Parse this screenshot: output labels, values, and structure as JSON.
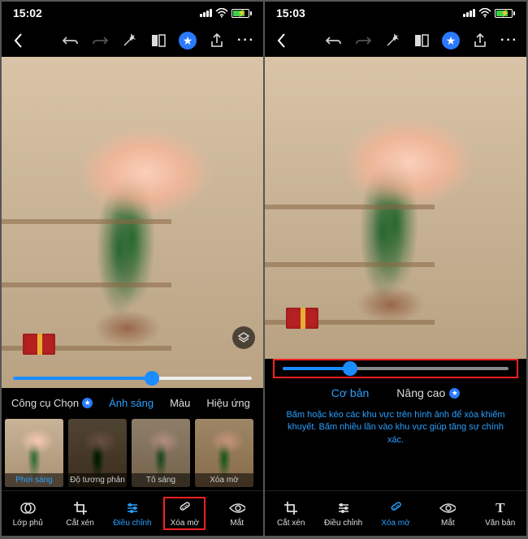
{
  "screens": [
    {
      "status": {
        "time": "15:02"
      },
      "slider": {
        "percent": 58
      },
      "category_tabs": [
        {
          "label": "Công cụ Chọn",
          "starred": true,
          "active": false
        },
        {
          "label": "Ánh sáng",
          "starred": false,
          "active": true
        },
        {
          "label": "Màu",
          "starred": false,
          "active": false
        },
        {
          "label": "Hiệu ứng",
          "starred": false,
          "active": false
        }
      ],
      "thumbs": [
        {
          "label": "Phơi sáng",
          "selected": true,
          "variant": ""
        },
        {
          "label": "Độ tương phản",
          "selected": false,
          "variant": "dark"
        },
        {
          "label": "Tô sáng",
          "selected": false,
          "variant": "mid"
        },
        {
          "label": "Xóa mờ",
          "selected": false,
          "variant": "warm"
        }
      ],
      "tools": [
        {
          "label": "Lớp phủ",
          "icon": "overlay",
          "active": false,
          "highlight": false
        },
        {
          "label": "Cắt xén",
          "icon": "crop",
          "active": false,
          "highlight": false
        },
        {
          "label": "Điều chỉnh",
          "icon": "adjust",
          "active": true,
          "highlight": false
        },
        {
          "label": "Xóa mờ",
          "icon": "heal",
          "active": false,
          "highlight": true
        },
        {
          "label": "Mắt",
          "icon": "eye",
          "active": false,
          "highlight": false
        }
      ]
    },
    {
      "status": {
        "time": "15:03"
      },
      "slider": {
        "percent": 30
      },
      "mode_tabs": [
        {
          "label": "Cơ bản",
          "starred": false,
          "active": true
        },
        {
          "label": "Nâng cao",
          "starred": true,
          "active": false
        }
      ],
      "hint": "Bấm hoặc kéo các khu vực trên hình ảnh để xóa khiếm khuyết. Bấm nhiều lần vào khu vực giúp tăng sự chính xác.",
      "tools": [
        {
          "label": "Cắt xén",
          "icon": "crop",
          "active": false
        },
        {
          "label": "Điều chỉnh",
          "icon": "adjust",
          "active": false
        },
        {
          "label": "Xóa mờ",
          "icon": "heal",
          "active": true
        },
        {
          "label": "Mắt",
          "icon": "eye",
          "active": false
        },
        {
          "label": "Văn bản",
          "icon": "text",
          "active": false
        }
      ]
    }
  ],
  "icons": {
    "overlay": "◯",
    "crop": "✂",
    "adjust": "☀",
    "heal": "✎",
    "eye": "◉",
    "text": "T"
  }
}
